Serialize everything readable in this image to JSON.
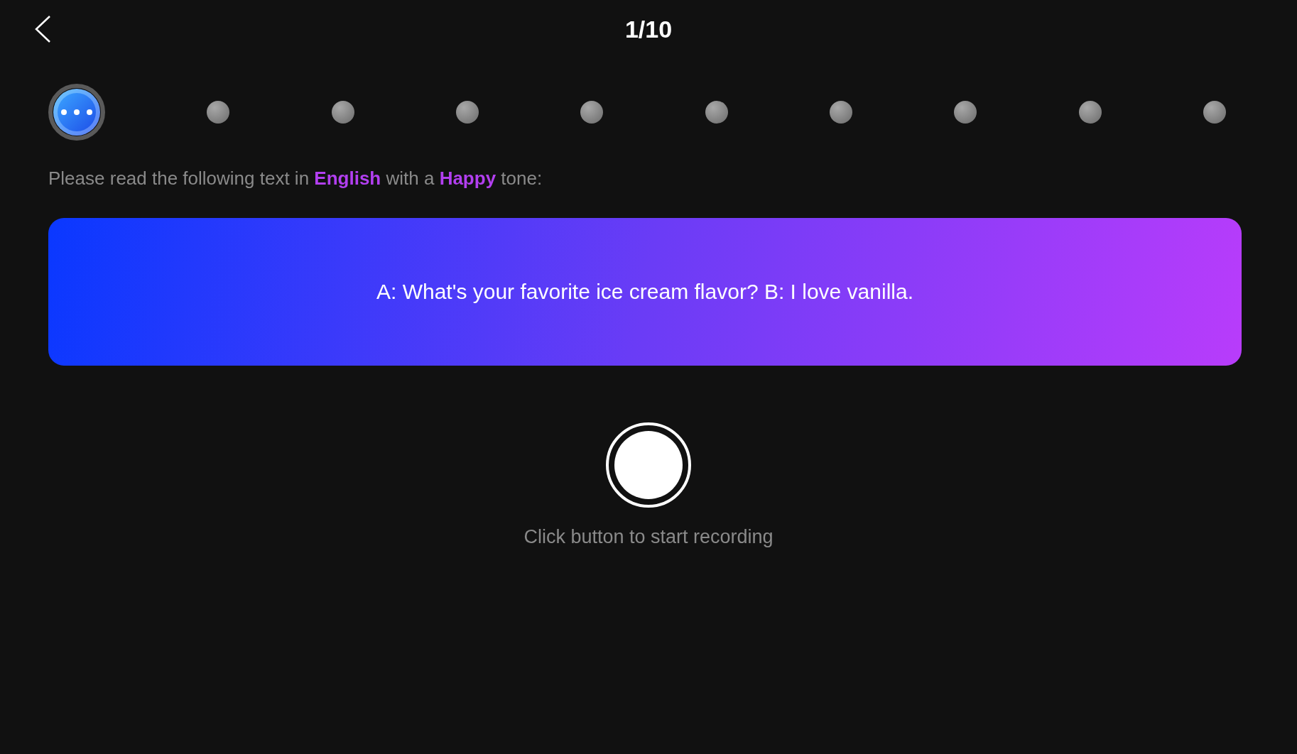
{
  "header": {
    "title": "1/10"
  },
  "steps": [
    {
      "selected": true
    },
    {
      "selected": false
    },
    {
      "selected": false
    },
    {
      "selected": false
    },
    {
      "selected": false
    },
    {
      "selected": false
    },
    {
      "selected": false
    },
    {
      "selected": false
    },
    {
      "selected": false
    },
    {
      "selected": false
    }
  ],
  "prompt": "Please read the following text in **English** with a **Happy** tone:",
  "card": {
    "text": "A: What's your favorite ice cream flavor? B: I love vanilla."
  },
  "record": {
    "caption": "Click button to start recording"
  }
}
